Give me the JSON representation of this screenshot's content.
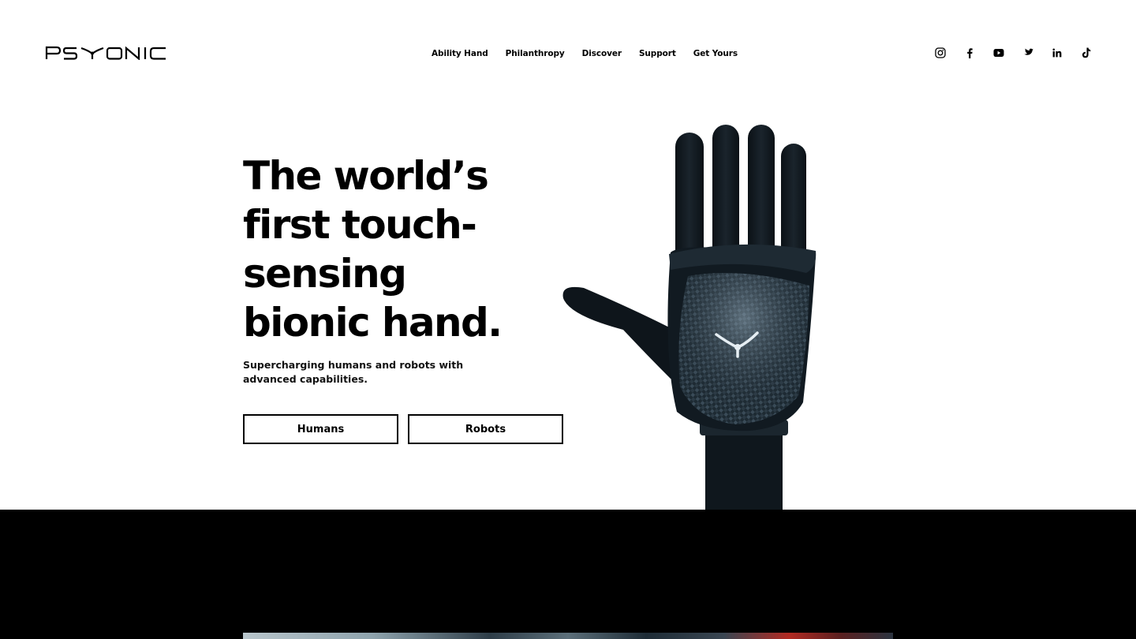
{
  "header": {
    "logo_text": "PSYONIC",
    "nav": [
      {
        "label": "Ability Hand"
      },
      {
        "label": "Philanthropy"
      },
      {
        "label": "Discover"
      },
      {
        "label": "Support"
      },
      {
        "label": "Get Yours"
      }
    ],
    "social_icons": [
      "instagram-icon",
      "facebook-icon",
      "youtube-icon",
      "twitter-icon",
      "linkedin-icon",
      "tiktok-icon"
    ]
  },
  "hero": {
    "title_lines": [
      "The world’s",
      "first touch-",
      "sensing",
      "bionic hand."
    ],
    "subtitle": "Supercharging humans and robots with advanced capabilities.",
    "buttons": {
      "humans": "Humans",
      "robots": "Robots"
    }
  },
  "colors": {
    "background": "#ffffff",
    "text": "#000000",
    "band": "#000000"
  }
}
